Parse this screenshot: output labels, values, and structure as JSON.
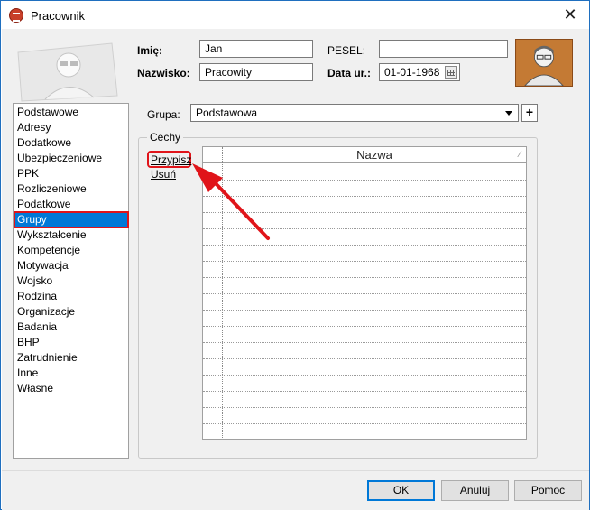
{
  "window": {
    "title": "Pracownik"
  },
  "form": {
    "imie_label": "Imię:",
    "imie_value": "Jan",
    "nazwisko_label": "Nazwisko:",
    "nazwisko_value": "Pracowity",
    "pesel_label": "PESEL:",
    "pesel_value": "",
    "data_label": "Data ur.:",
    "data_value": "01-01-1968"
  },
  "nav": {
    "items": [
      {
        "label": "Podstawowe"
      },
      {
        "label": "Adresy"
      },
      {
        "label": "Dodatkowe"
      },
      {
        "label": "Ubezpieczeniowe"
      },
      {
        "label": "PPK"
      },
      {
        "label": "Rozliczeniowe"
      },
      {
        "label": "Podatkowe"
      },
      {
        "label": "Grupy",
        "selected": true
      },
      {
        "label": "Wykształcenie"
      },
      {
        "label": "Kompetencje"
      },
      {
        "label": "Motywacja"
      },
      {
        "label": "Wojsko"
      },
      {
        "label": "Rodzina"
      },
      {
        "label": "Organizacje"
      },
      {
        "label": "Badania"
      },
      {
        "label": "BHP"
      },
      {
        "label": "Zatrudnienie"
      },
      {
        "label": "Inne"
      },
      {
        "label": "Własne"
      }
    ]
  },
  "grupa": {
    "label": "Grupa:",
    "value": "Podstawowa",
    "add_label": "+"
  },
  "cechy": {
    "legend": "Cechy",
    "assign_link": "Przypisz",
    "remove_link": "Usuń",
    "grid": {
      "column": "Nazwa",
      "row_count": 17
    }
  },
  "footer": {
    "ok_label": "OK",
    "cancel_label": "Anuluj",
    "help_label": "Pomoc"
  },
  "colors": {
    "selection": "#0078d7",
    "highlight": "#e0141a",
    "panel_bg": "#f0f0f0"
  }
}
